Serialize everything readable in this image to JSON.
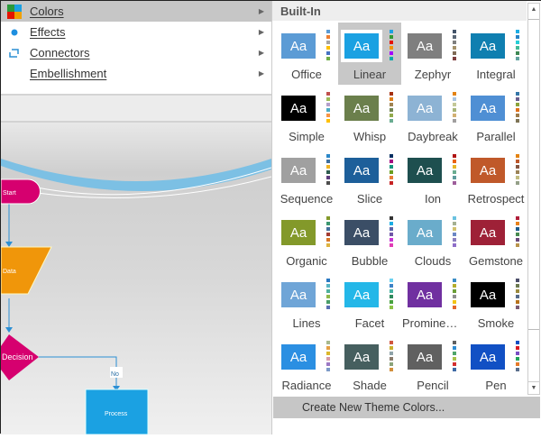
{
  "menu": {
    "items": [
      {
        "label": "Colors",
        "icon": "theme-colors-icon",
        "active": true
      },
      {
        "label": "Effects",
        "icon": "effects-dot-icon"
      },
      {
        "label": "Connectors",
        "icon": "connector-icon"
      },
      {
        "label": "Embellishment",
        "icon": ""
      }
    ]
  },
  "gallery": {
    "header": "Built-In",
    "selected": "Linear",
    "footer": "Create New Theme Colors...",
    "themes": [
      {
        "name": "Office",
        "color": "#5b9bd5",
        "dots": [
          "#5b9bd5",
          "#ed7d31",
          "#a5a5a5",
          "#ffc000",
          "#4472c4",
          "#70ad47"
        ]
      },
      {
        "name": "Linear",
        "color": "#1ba1e2",
        "dots": [
          "#1ba1e2",
          "#339933",
          "#e51400",
          "#f09609",
          "#a200ff",
          "#00aba9"
        ]
      },
      {
        "name": "Zephyr",
        "color": "#7f7f7f",
        "dots": [
          "#44546a",
          "#5a6776",
          "#7f7f7f",
          "#a5926b",
          "#7f6a55",
          "#7f3f3f"
        ]
      },
      {
        "name": "Integral",
        "color": "#0f7fb0",
        "dots": [
          "#1cade4",
          "#2683c6",
          "#27ced7",
          "#42ba97",
          "#3e8853",
          "#62a39f"
        ]
      },
      {
        "name": "Simple",
        "color": "#000000",
        "dots": [
          "#c0504d",
          "#9bbb59",
          "#b4a0cc",
          "#4bacc6",
          "#f79646",
          "#ffc000"
        ]
      },
      {
        "name": "Whisp",
        "color": "#6b7f4c",
        "dots": [
          "#a53010",
          "#de7e18",
          "#9f8351",
          "#728653",
          "#92aa4c",
          "#6aac91"
        ]
      },
      {
        "name": "Daybreak",
        "color": "#8db3d4",
        "dots": [
          "#e48312",
          "#a9c4e1",
          "#c3c898",
          "#a8b57a",
          "#d2b072",
          "#a19f9f"
        ]
      },
      {
        "name": "Parallel",
        "color": "#4f8fd4",
        "dots": [
          "#3476a8",
          "#6a5e8e",
          "#8aa33c",
          "#e0701b",
          "#9e7c4b",
          "#7e7456"
        ]
      },
      {
        "name": "Sequence",
        "color": "#a0a0a0",
        "dots": [
          "#2b87c8",
          "#3e6f9f",
          "#f0b323",
          "#2e5c4f",
          "#5e3c7e",
          "#4d4d4d"
        ]
      },
      {
        "name": "Slice",
        "color": "#1d5f9a",
        "dots": [
          "#052f61",
          "#a50e82",
          "#14967c",
          "#6a9e1f",
          "#e87d37",
          "#c62324"
        ]
      },
      {
        "name": "Ion",
        "color": "#1e4f4f",
        "dots": [
          "#b01513",
          "#ea6312",
          "#e6b729",
          "#6aac90",
          "#5f9c9d",
          "#9e5e9b"
        ]
      },
      {
        "name": "Retrospect",
        "color": "#c0592a",
        "dots": [
          "#e48312",
          "#bd582c",
          "#865640",
          "#9b8357",
          "#c2bc80",
          "#94a088"
        ]
      },
      {
        "name": "Organic",
        "color": "#83992a",
        "dots": [
          "#83992a",
          "#3c9770",
          "#44709d",
          "#a23c33",
          "#d97828",
          "#deb340"
        ]
      },
      {
        "name": "Bubble",
        "color": "#3b4e66",
        "dots": [
          "#333333",
          "#1cade4",
          "#5a62a8",
          "#6f55a7",
          "#c734d6",
          "#e13bb5"
        ]
      },
      {
        "name": "Clouds",
        "color": "#6aaccb",
        "dots": [
          "#6ac2e0",
          "#a4b092",
          "#d3c26e",
          "#6b87c5",
          "#8c7fbf",
          "#8e6ec9"
        ]
      },
      {
        "name": "Gemstone",
        "color": "#9e2137",
        "dots": [
          "#b01f3a",
          "#e8821b",
          "#1d5b8c",
          "#478a4f",
          "#6b4a7c",
          "#b9944b"
        ]
      },
      {
        "name": "Lines",
        "color": "#6fa5d7",
        "dots": [
          "#2b79c2",
          "#5ab5c4",
          "#4eb09b",
          "#8fb74a",
          "#4a9d69",
          "#5a6fb4"
        ]
      },
      {
        "name": "Facet",
        "color": "#24b7e8",
        "dots": [
          "#6ad0f0",
          "#3c82c6",
          "#45b2a0",
          "#2e8a5d",
          "#48a23f",
          "#8bc346"
        ]
      },
      {
        "name": "Prominence",
        "color": "#7030a0",
        "dots": [
          "#3c8dc6",
          "#b4ad2c",
          "#6b9e38",
          "#8f8f8f",
          "#f2c314",
          "#e4662b"
        ]
      },
      {
        "name": "Smoke",
        "color": "#000000",
        "dots": [
          "#4d4f6b",
          "#6d7b52",
          "#9b8a3e",
          "#566b8a",
          "#b8731c",
          "#7a5b75"
        ]
      },
      {
        "name": "Radiance",
        "color": "#2b8fe2",
        "dots": [
          "#a8b98e",
          "#e7a044",
          "#dcb72b",
          "#d69aa6",
          "#9c78c4",
          "#7d9bc8"
        ]
      },
      {
        "name": "Shade",
        "color": "#465f5f",
        "dots": [
          "#d0573f",
          "#c9b02c",
          "#8fa3a9",
          "#8a7b6b",
          "#8aa37a",
          "#d28f3c"
        ]
      },
      {
        "name": "Pencil",
        "color": "#606060",
        "dots": [
          "#606060",
          "#2f8dd3",
          "#4ea56a",
          "#a8c24a",
          "#d32f2f",
          "#3f6aa5"
        ]
      },
      {
        "name": "Pen",
        "color": "#1150c4",
        "dots": [
          "#1150c4",
          "#d81b24",
          "#7a4ec4",
          "#22a45c",
          "#e57a2a",
          "#5a6f8c"
        ]
      }
    ]
  },
  "diagram": {
    "start": "Start",
    "data": "Data",
    "decision": "Decision",
    "no": "No",
    "process": "Process"
  }
}
